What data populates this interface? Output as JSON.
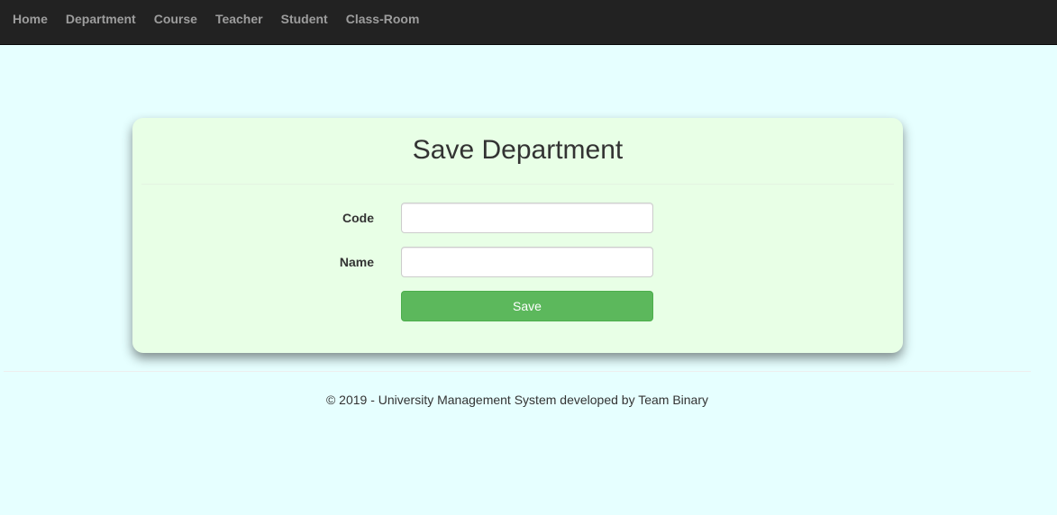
{
  "nav": {
    "items": [
      {
        "label": "Home"
      },
      {
        "label": "Department"
      },
      {
        "label": "Course"
      },
      {
        "label": "Teacher"
      },
      {
        "label": "Student"
      },
      {
        "label": "Class-Room"
      }
    ]
  },
  "form": {
    "title": "Save Department",
    "code_label": "Code",
    "code_value": "",
    "name_label": "Name",
    "name_value": "",
    "save_label": "Save"
  },
  "footer": {
    "text": "© 2019 - University Management System developed by Team Binary"
  },
  "colors": {
    "navbar_bg": "#222222",
    "nav_text": "#9d9d9d",
    "page_bg": "#e6ffff",
    "card_bg": "#e8ffe6",
    "save_button": "#5cb85c"
  }
}
